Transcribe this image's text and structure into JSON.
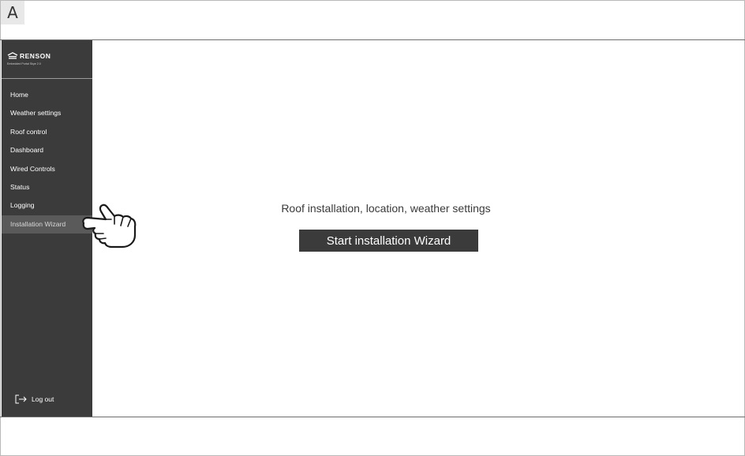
{
  "figure_label": "A",
  "brand": {
    "name": "RENSON",
    "subtitle": "Embedded Portal Skye 2.0"
  },
  "sidebar": {
    "items": [
      {
        "label": "Home"
      },
      {
        "label": "Weather settings"
      },
      {
        "label": "Roof control"
      },
      {
        "label": "Dashboard"
      },
      {
        "label": "Wired Controls"
      },
      {
        "label": "Status"
      },
      {
        "label": "Logging"
      },
      {
        "label": "Installation Wizard",
        "active": true
      }
    ],
    "logout_label": "Log out"
  },
  "main": {
    "heading": "Roof installation, location, weather settings",
    "start_button_label": "Start installation Wizard"
  },
  "icons": {
    "brand_logo": "renson-logo-icon",
    "logout": "logout-icon",
    "pointer": "hand-pointer-icon"
  },
  "colors": {
    "sidebar_bg": "#3b3b3b",
    "active_item_bg": "#5a5a5a",
    "button_bg": "#3b3b3b",
    "text_main": "#3a3a3a"
  }
}
